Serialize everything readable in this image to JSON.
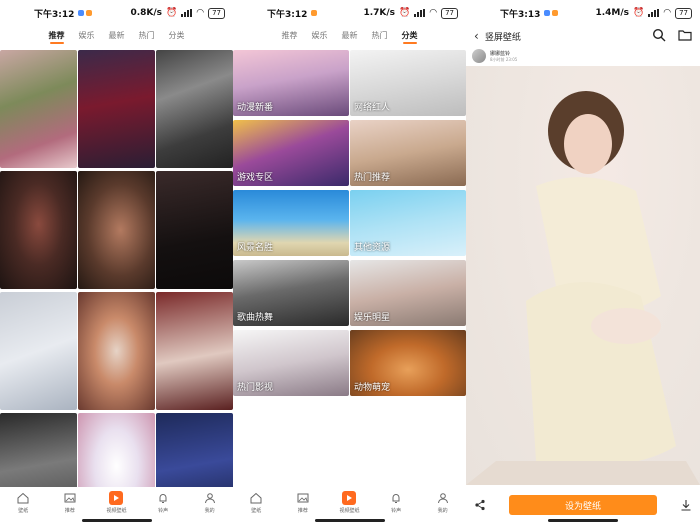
{
  "panels": [
    {
      "status": {
        "time": "下午3:12",
        "speed": "0.8K/s",
        "battery": "77"
      }
    },
    {
      "status": {
        "time": "下午3:12",
        "speed": "1.7K/s",
        "battery": "77"
      }
    },
    {
      "status": {
        "time": "下午3:13",
        "speed": "1.4M/s",
        "battery": "77"
      }
    }
  ],
  "tabs": [
    "推荐",
    "娱乐",
    "最新",
    "热门",
    "分类"
  ],
  "categories": [
    "动漫新番",
    "网络红人",
    "游戏专区",
    "热门推荐",
    "风景名胜",
    "其他资源",
    "歌曲热舞",
    "娱乐明星",
    "热门影视",
    "动物萌宠"
  ],
  "nav": [
    "壁纸",
    "推荐",
    "视频壁纸",
    "铃声",
    "我的"
  ],
  "detail": {
    "title": "竖屏壁纸",
    "author": "娜娜蓝铃",
    "time": "8小时前 23:05",
    "set_button": "设为壁纸"
  },
  "colors": {
    "accent": "#ff7a21",
    "button": "#ff8c1a"
  }
}
